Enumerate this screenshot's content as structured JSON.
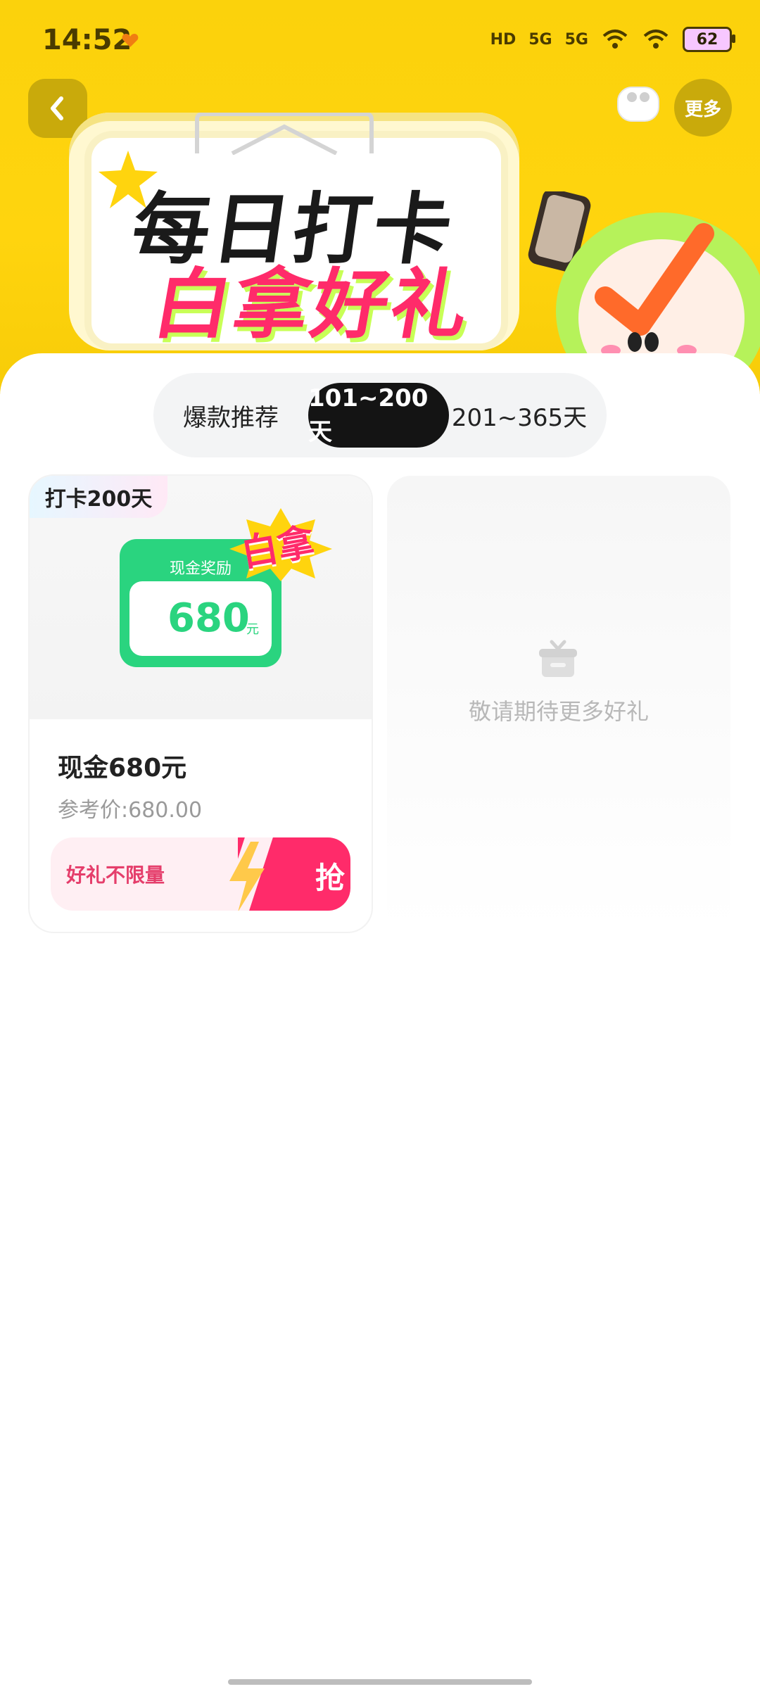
{
  "status_bar": {
    "time": "14:52",
    "network_1": "HD",
    "network_2": "5G",
    "network_3": "5G",
    "battery": "62"
  },
  "header": {
    "back_icon": "chevron-left-icon",
    "more_label": "更多"
  },
  "hero": {
    "title_line1": "每日打卡",
    "title_line2": "白拿好礼"
  },
  "tabs": [
    {
      "label": "爆款推荐",
      "selected": false
    },
    {
      "label": "101~200天",
      "selected": true
    },
    {
      "label": "201~365天",
      "selected": false
    }
  ],
  "product": {
    "badge": "打卡200天",
    "cash_label": "现金奖励",
    "cash_amount": "680",
    "cash_unit": "元",
    "sticker": "白拿",
    "title": "现金680元",
    "ref_price": "参考价:680.00",
    "promo_label": "好礼不限量",
    "grab_label": "抢"
  },
  "placeholder": {
    "icon": "gift-icon",
    "text": "敬请期待更多好礼"
  },
  "colors": {
    "banner": "#FFD40E",
    "accent_pink": "#FF2B6A",
    "accent_green": "#2AD47F",
    "tab_selected_bg": "#141414"
  }
}
